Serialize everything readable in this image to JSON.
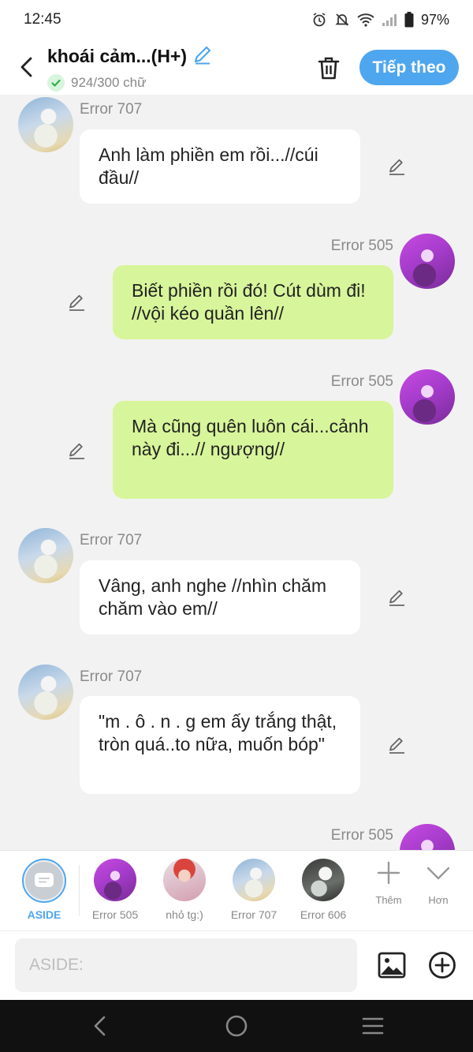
{
  "status_bar": {
    "time": "12:45",
    "battery": "97%"
  },
  "header": {
    "title": "khoái cảm...(H+)",
    "char_count": "924/300 chữ",
    "next_button": "Tiếp theo"
  },
  "messages": [
    {
      "sender": "Error 707",
      "side": "left",
      "text": "Anh làm phiền em rồi...//cúi đầu//"
    },
    {
      "sender": "Error 505",
      "side": "right",
      "text": "Biết phiền rồi đó! Cút dùm đi! //vội kéo quần lên//"
    },
    {
      "sender": "Error 505",
      "side": "right",
      "text": "Mà cũng quên luôn cái...cảnh này đi...// ngượng//"
    },
    {
      "sender": "Error 707",
      "side": "left",
      "text": "Vâng, anh nghe //nhìn chăm chăm vào em//"
    },
    {
      "sender": "Error 707",
      "side": "left",
      "text": "\"m . ô . n . g em ấy trắng thật, tròn quá..to nữa, muốn bóp\""
    },
    {
      "sender": "Error 505",
      "side": "right",
      "text": ""
    }
  ],
  "characters": [
    {
      "label": "ASIDE",
      "active": true
    },
    {
      "label": "Error 505"
    },
    {
      "label": "nhỏ tg:)"
    },
    {
      "label": "Error 707"
    },
    {
      "label": "Error 606"
    }
  ],
  "tools": [
    {
      "label": "Thêm",
      "icon": "plus-icon"
    },
    {
      "label": "Hơn",
      "icon": "chevron-down-icon"
    }
  ],
  "input": {
    "placeholder": "ASIDE:"
  },
  "colors": {
    "accent": "#4ea6ef",
    "green_bubble": "#d7f59a",
    "background": "#f2f2f2"
  }
}
